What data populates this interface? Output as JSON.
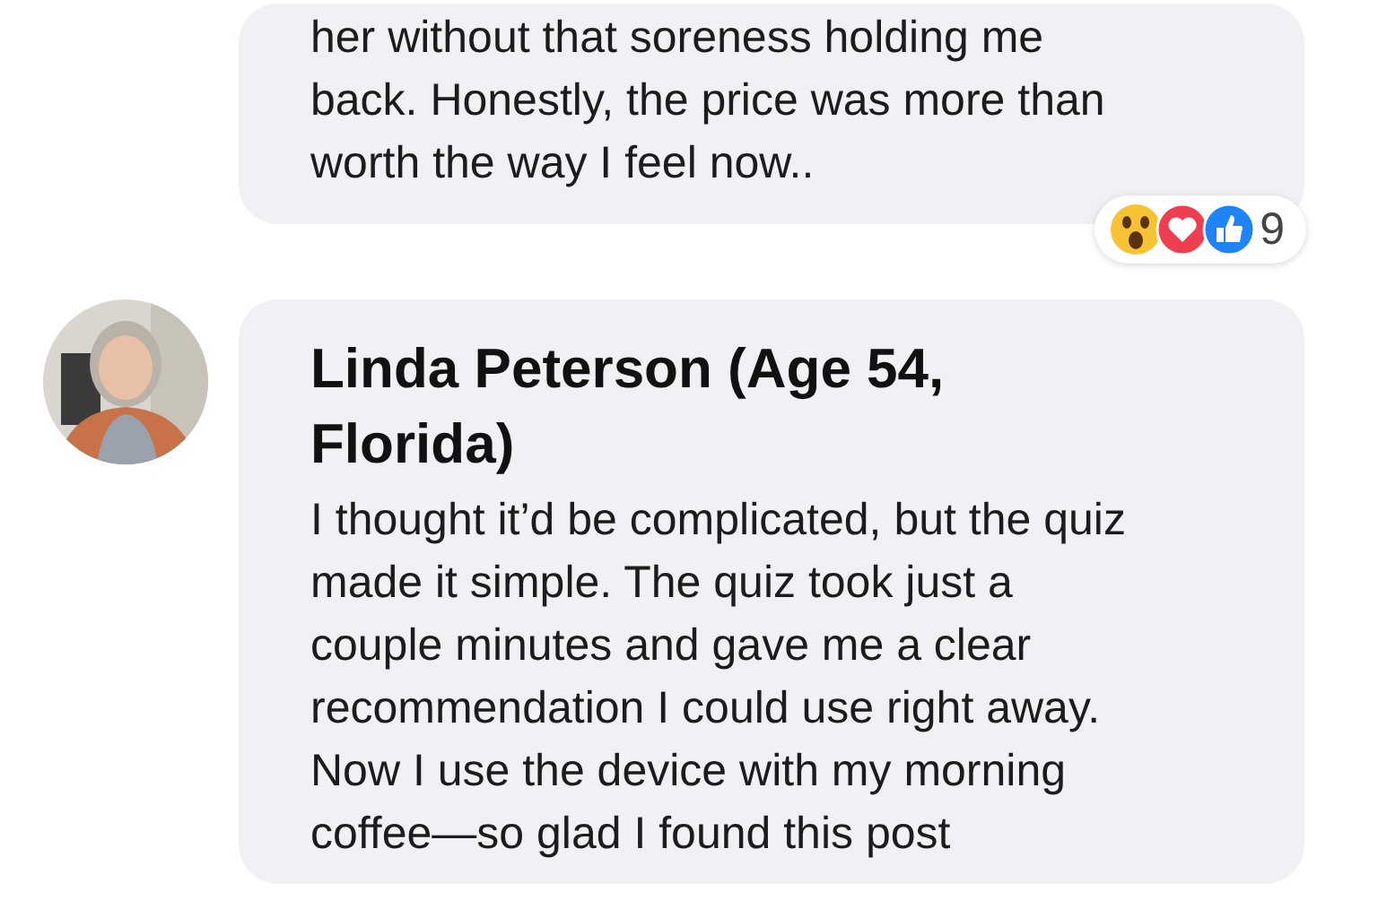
{
  "comments": [
    {
      "lines": [
        "her without that soreness holding me",
        "back. Honestly, the price was more than",
        "worth the way I feel now.."
      ],
      "reactions": {
        "count": "9"
      }
    },
    {
      "author": "Linda Peterson (Age 54, Florida)",
      "lines": [
        "I thought it’d be complicated, but the quiz",
        "made it simple. The quiz took just a",
        "couple minutes and gave me a clear",
        "recommendation I could use right away.",
        "Now I use the device with my morning",
        "coffee—so glad I found this post"
      ]
    }
  ]
}
